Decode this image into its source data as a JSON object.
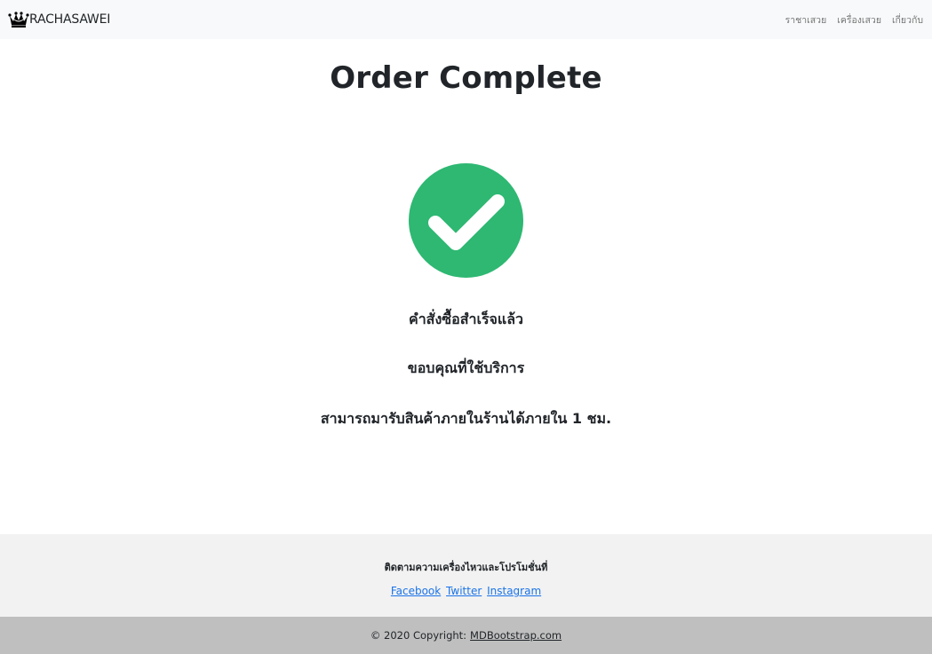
{
  "navbar": {
    "brand_text": "RACHASAWEI",
    "links": [
      "ราชาเสวย",
      "เครื่องเสวย",
      "เกี่ยวกับ"
    ]
  },
  "main": {
    "title": "Order Complete",
    "messages": [
      "คำสั่งซื้อสำเร็จแล้ว",
      "ขอบคุณที่ใช้บริการ",
      "สามารถมารับสินค้าภายในร้านได้ภายใน 1 ชม."
    ],
    "success_color": "#2eb872"
  },
  "footer": {
    "heading": "ติดตามความเครื่องไหวและโปรโมชั่นที่",
    "social_links": [
      "Facebook",
      "Twitter",
      "Instagram"
    ],
    "copyright_prefix": "© 2020 Copyright:",
    "copyright_link": "MDBootstrap.com"
  }
}
